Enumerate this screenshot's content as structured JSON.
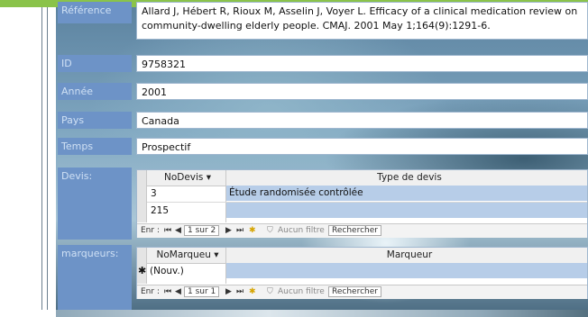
{
  "reference": {
    "label": "Référence",
    "value_line1": "Allard J, Hébert R, Rioux M, Asselin J, Voyer L. Efficacy of a clinical medication review on",
    "value_line2": "community-dwelling elderly people. CMAJ. 2001 May 1;164(9):1291-6."
  },
  "fields": [
    {
      "label": "ID",
      "value": "9758321"
    },
    {
      "label": "Année",
      "value": "2001"
    },
    {
      "label": "Pays",
      "value": "Canada"
    },
    {
      "label": "Temps",
      "value": "Prospectif"
    }
  ],
  "devis": {
    "label": "Devis:",
    "col1": "NoDevis",
    "col2": "Type de devis",
    "rows": [
      {
        "no": "3",
        "type": "Étude randomisée contrôlée"
      },
      {
        "no": "215",
        "type": ""
      }
    ],
    "nav": {
      "enr": "Enr :",
      "pos": "1 sur 2",
      "filter": "Aucun filtre",
      "search": "Rechercher"
    }
  },
  "marqueurs": {
    "label": "marqueurs:",
    "col1": "NoMarqueu",
    "col2": "Marqueur",
    "new_row_marker": "✱",
    "new_row_text": "(Nouv.)",
    "nav": {
      "enr": "Enr :",
      "pos": "1 sur 1",
      "filter": "Aucun filtre",
      "search": "Rechercher"
    }
  },
  "colors": {
    "label_bg": "#6d93c7",
    "label_text": "#cfe0f4",
    "top_bar": "#8ac34a"
  }
}
